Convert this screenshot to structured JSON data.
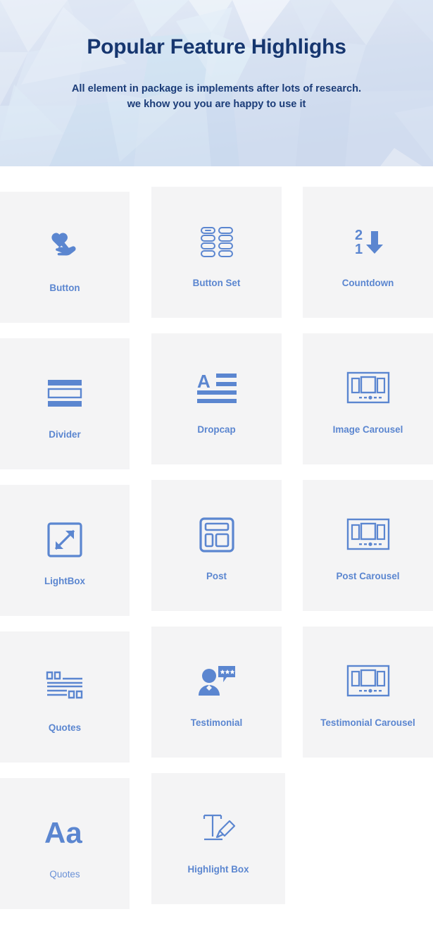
{
  "hero": {
    "title": "Popular Feature Highlighs",
    "subtitle_line1": "All element in package is implements after lots of research.",
    "subtitle_line2": "we khow you you are happy to use it",
    "bg_base": "#ccd7ec",
    "title_color": "#16366f",
    "subtitle_color": "#1b3c78"
  },
  "theme": {
    "card_bg": "#f4f4f5",
    "icon_color": "#5b86d0",
    "label_color": "#5b86d0",
    "page_bg": "#ffffff"
  },
  "features": [
    {
      "label": "Button",
      "icon": "hand-pointer-heart-icon"
    },
    {
      "label": "Button Set",
      "icon": "button-grid-icon"
    },
    {
      "label": "Countdown",
      "icon": "countdown-arrow-icon",
      "digits": [
        "2",
        "1"
      ]
    },
    {
      "label": "Divider",
      "icon": "divider-icon"
    },
    {
      "label": "Dropcap",
      "icon": "dropcap-a-icon",
      "glyph": "A"
    },
    {
      "label": "Image Carousel",
      "icon": "carousel-icon"
    },
    {
      "label": "LightBox",
      "icon": "expand-arrows-icon"
    },
    {
      "label": "Post",
      "icon": "post-layout-icon"
    },
    {
      "label": "Post Carousel",
      "icon": "carousel-icon"
    },
    {
      "label": "Quotes",
      "icon": "quote-lines-icon"
    },
    {
      "label": "Testimonial",
      "icon": "person-speech-stars-icon"
    },
    {
      "label": "Testimonial Carousel",
      "icon": "carousel-icon"
    },
    {
      "label": "Quotes",
      "icon": "typography-aa-icon",
      "glyph": "Aa"
    },
    {
      "label": "Highlight Box",
      "icon": "text-highlighter-icon"
    }
  ]
}
